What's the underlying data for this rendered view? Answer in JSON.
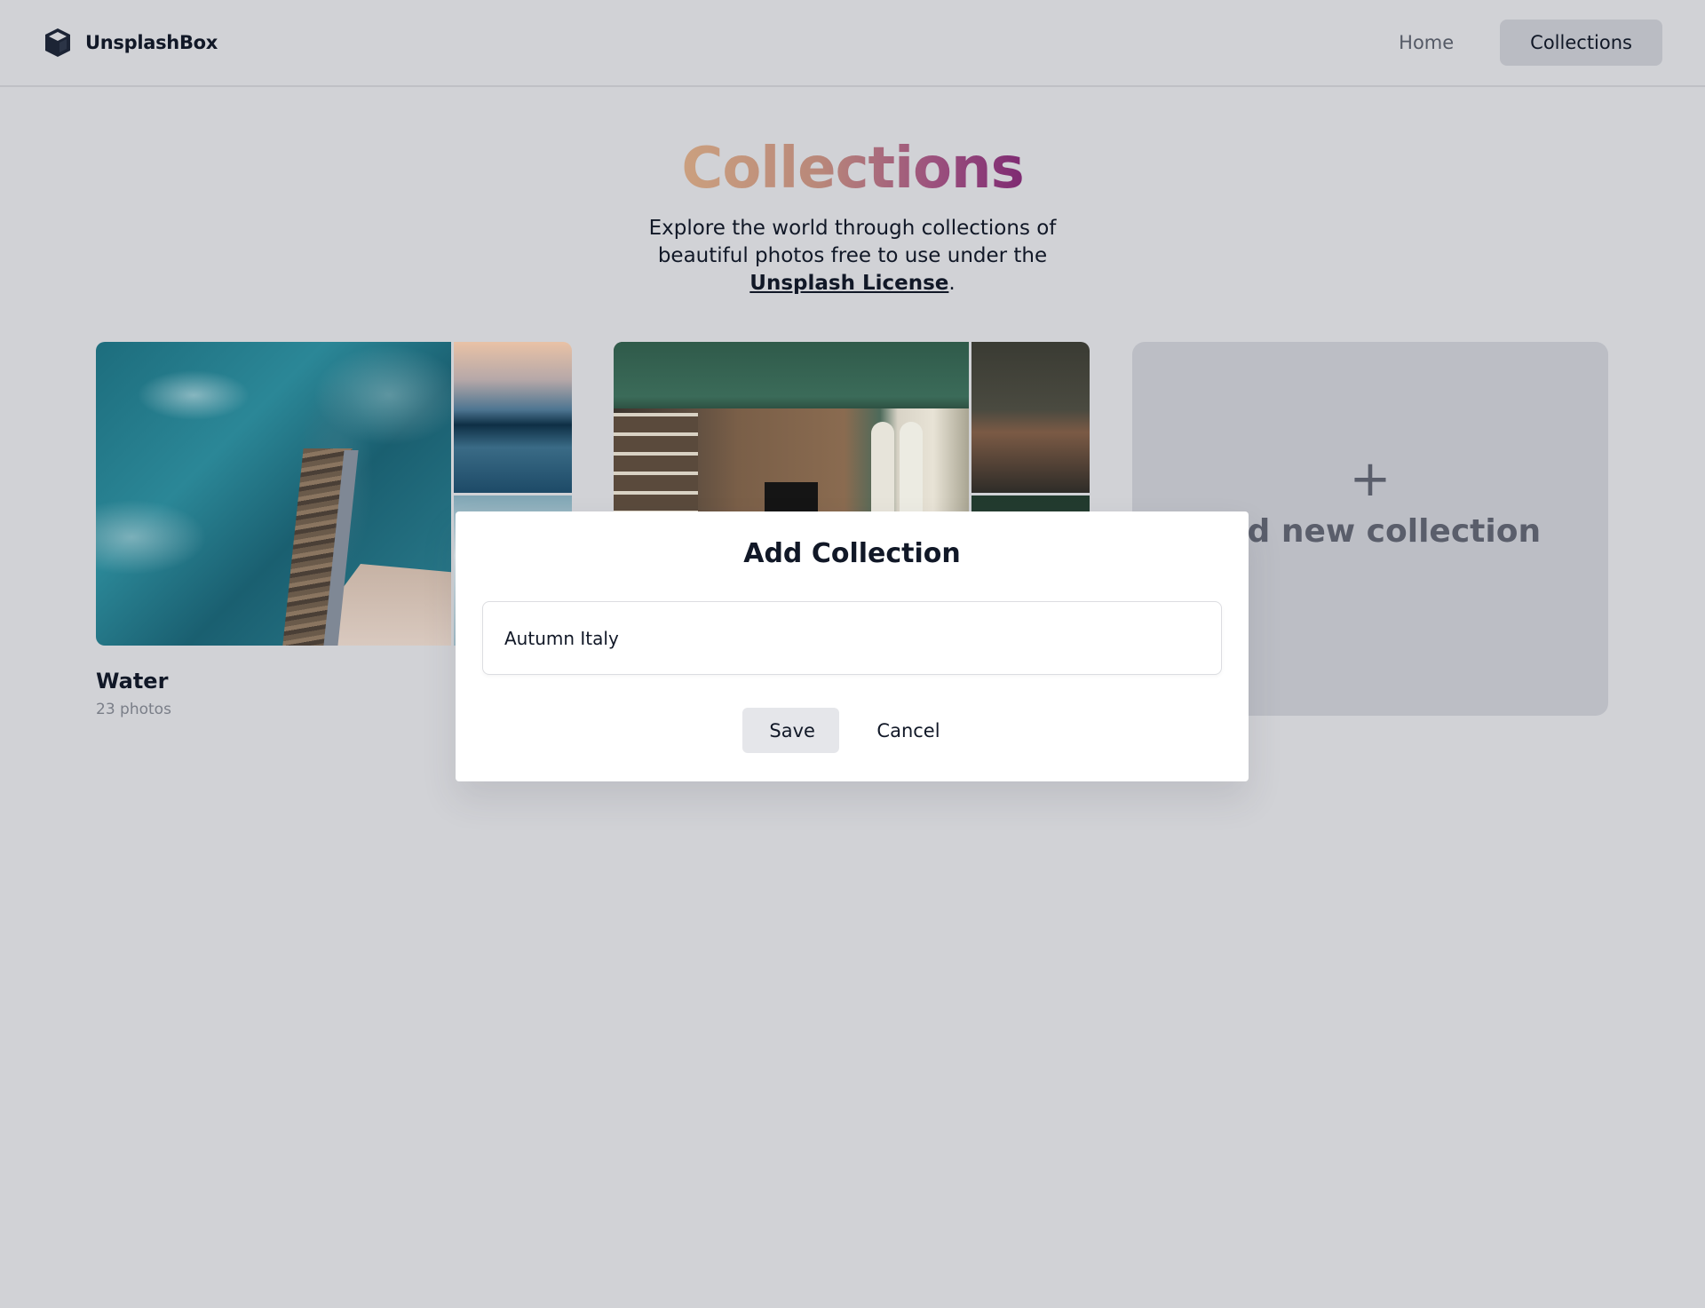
{
  "app": {
    "name": "UnsplashBox",
    "logo_icon": "cube-icon"
  },
  "nav": {
    "items": [
      {
        "label": "Home",
        "active": false
      },
      {
        "label": "Collections",
        "active": true
      }
    ]
  },
  "hero": {
    "title": "Collections",
    "subtitle_prefix": "Explore the world through collections of beautiful photos free to use under the ",
    "subtitle_link": "Unsplash License",
    "subtitle_suffix": "."
  },
  "collections": [
    {
      "title": "Water",
      "count": "23 photos"
    },
    {
      "title": "",
      "count": ""
    }
  ],
  "add_card": {
    "icon": "plus-icon",
    "label": "Add new collection"
  },
  "modal": {
    "title": "Add Collection",
    "input_value": "Autumn Italy",
    "save_label": "Save",
    "cancel_label": "Cancel"
  },
  "colors": {
    "background": "#d1d2d6",
    "title_gradient_start": "#cba07f",
    "title_gradient_end": "#7e2a72",
    "active_nav": "#babcc3",
    "save_button": "#e5e6ea"
  }
}
